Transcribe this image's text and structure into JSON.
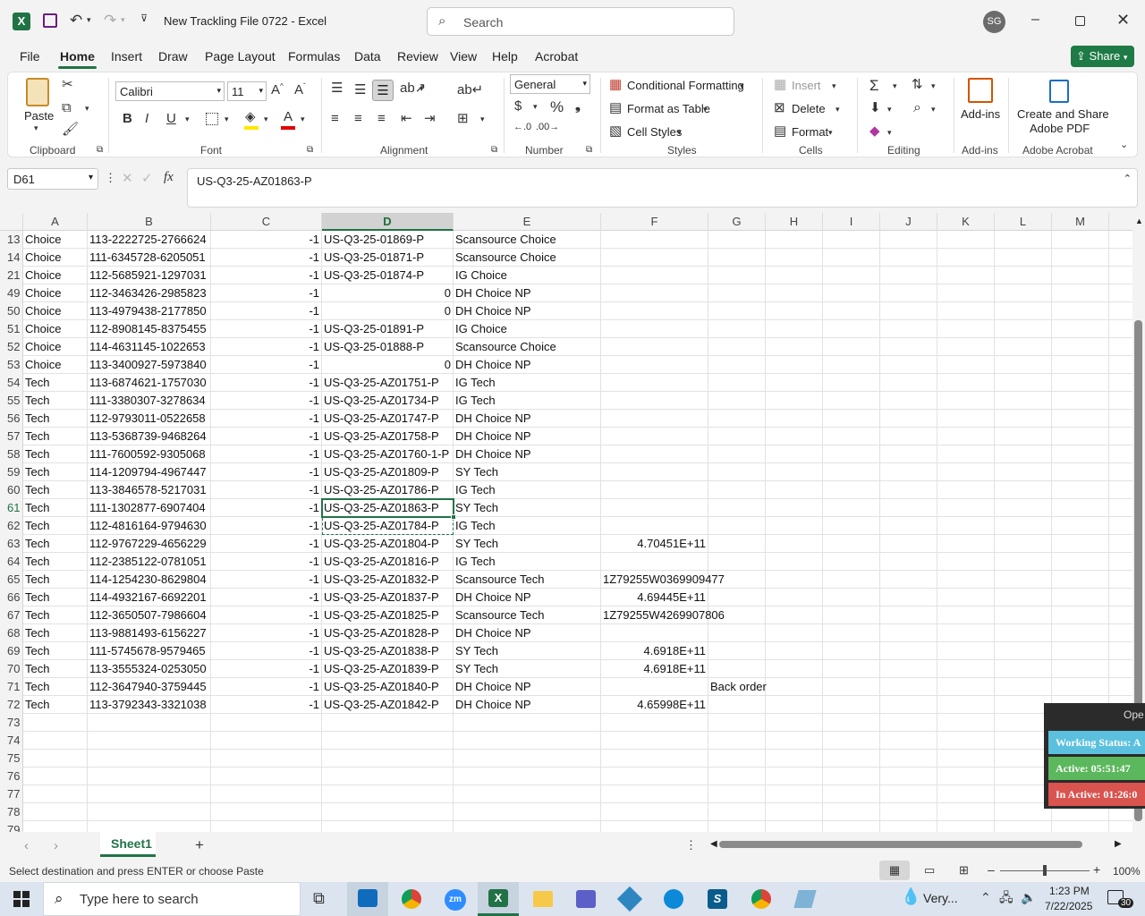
{
  "window": {
    "title": "New Trackling File 0722  -  Excel",
    "search_placeholder": "Search",
    "user_initials": "SG"
  },
  "menu": [
    "File",
    "Home",
    "Insert",
    "Draw",
    "Page Layout",
    "Formulas",
    "Data",
    "Review",
    "View",
    "Help",
    "Acrobat"
  ],
  "share_label": "Share",
  "ribbon": {
    "paste": "Paste",
    "font_name": "Calibri",
    "font_size": "11",
    "number_format": "General",
    "conditional_formatting": "Conditional Formatting",
    "format_as_table": "Format as Table",
    "cell_styles": "Cell Styles",
    "insert": "Insert",
    "delete": "Delete",
    "format": "Format",
    "add_ins": "Add-ins",
    "create_share_1": "Create and Share",
    "create_share_2": "Adobe PDF",
    "groups": {
      "clipboard": "Clipboard",
      "font": "Font",
      "alignment": "Alignment",
      "number": "Number",
      "styles": "Styles",
      "cells": "Cells",
      "editing": "Editing",
      "addins": "Add-ins",
      "acrobat": "Adobe Acrobat"
    }
  },
  "formula_bar": {
    "name_box": "D61",
    "fx": "fx",
    "content": "US-Q3-25-AZ01863-P"
  },
  "columns": [
    "A",
    "B",
    "C",
    "D",
    "E",
    "F",
    "G",
    "H",
    "I",
    "J",
    "K",
    "L",
    "M"
  ],
  "rows": [
    {
      "n": "13",
      "a": "Choice",
      "b": "113-2222725-2766624",
      "c": "-1",
      "d": "US-Q3-25-01869-P",
      "e": "Scansource Choice",
      "f": "",
      "g": ""
    },
    {
      "n": "14",
      "a": "Choice",
      "b": "111-6345728-6205051",
      "c": "-1",
      "d": "US-Q3-25-01871-P",
      "e": "Scansource Choice",
      "f": "",
      "g": ""
    },
    {
      "n": "21",
      "a": "Choice",
      "b": "112-5685921-1297031",
      "c": "-1",
      "d": "US-Q3-25-01874-P",
      "e": "IG Choice",
      "f": "",
      "g": ""
    },
    {
      "n": "49",
      "a": "Choice",
      "b": "112-3463426-2985823",
      "c": "-1",
      "d": "0",
      "e": "DH Choice NP",
      "f": "",
      "g": ""
    },
    {
      "n": "50",
      "a": "Choice",
      "b": "113-4979438-2177850",
      "c": "-1",
      "d": "0",
      "e": "DH Choice NP",
      "f": "",
      "g": ""
    },
    {
      "n": "51",
      "a": "Choice",
      "b": "112-8908145-8375455",
      "c": "-1",
      "d": "US-Q3-25-01891-P",
      "e": "IG Choice",
      "f": "",
      "g": ""
    },
    {
      "n": "52",
      "a": "Choice",
      "b": "114-4631145-1022653",
      "c": "-1",
      "d": "US-Q3-25-01888-P",
      "e": "Scansource Choice",
      "f": "",
      "g": ""
    },
    {
      "n": "53",
      "a": "Choice",
      "b": "113-3400927-5973840",
      "c": "-1",
      "d": "0",
      "e": "DH Choice NP",
      "f": "",
      "g": ""
    },
    {
      "n": "54",
      "a": "Tech",
      "b": "113-6874621-1757030",
      "c": "-1",
      "d": "US-Q3-25-AZ01751-P",
      "e": "IG Tech",
      "f": "",
      "g": ""
    },
    {
      "n": "55",
      "a": "Tech",
      "b": "111-3380307-3278634",
      "c": "-1",
      "d": "US-Q3-25-AZ01734-P",
      "e": "IG Tech",
      "f": "",
      "g": ""
    },
    {
      "n": "56",
      "a": "Tech",
      "b": "112-9793011-0522658",
      "c": "-1",
      "d": "US-Q3-25-AZ01747-P",
      "e": "DH Choice NP",
      "f": "",
      "g": ""
    },
    {
      "n": "57",
      "a": "Tech",
      "b": "113-5368739-9468264",
      "c": "-1",
      "d": "US-Q3-25-AZ01758-P",
      "e": "DH Choice NP",
      "f": "",
      "g": ""
    },
    {
      "n": "58",
      "a": "Tech",
      "b": "111-7600592-9305068",
      "c": "-1",
      "d": "US-Q3-25-AZ01760-1-P",
      "e": "DH Choice NP",
      "f": "",
      "g": ""
    },
    {
      "n": "59",
      "a": "Tech",
      "b": "114-1209794-4967447",
      "c": "-1",
      "d": "US-Q3-25-AZ01809-P",
      "e": "SY Tech",
      "f": "",
      "g": ""
    },
    {
      "n": "60",
      "a": "Tech",
      "b": "113-3846578-5217031",
      "c": "-1",
      "d": "US-Q3-25-AZ01786-P",
      "e": "IG Tech",
      "f": "",
      "g": ""
    },
    {
      "n": "61",
      "a": "Tech",
      "b": "111-1302877-6907404",
      "c": "-1",
      "d": "US-Q3-25-AZ01863-P",
      "e": "SY Tech",
      "f": "",
      "g": ""
    },
    {
      "n": "62",
      "a": "Tech",
      "b": "112-4816164-9794630",
      "c": "-1",
      "d": "US-Q3-25-AZ01784-P",
      "e": "IG Tech",
      "f": "",
      "g": ""
    },
    {
      "n": "63",
      "a": "Tech",
      "b": "112-9767229-4656229",
      "c": "-1",
      "d": "US-Q3-25-AZ01804-P",
      "e": "SY Tech",
      "f": "4.70451E+11",
      "g": ""
    },
    {
      "n": "64",
      "a": "Tech",
      "b": "112-2385122-0781051",
      "c": "-1",
      "d": "US-Q3-25-AZ01816-P",
      "e": "IG Tech",
      "f": "",
      "g": ""
    },
    {
      "n": "65",
      "a": "Tech",
      "b": "114-1254230-8629804",
      "c": "-1",
      "d": "US-Q3-25-AZ01832-P",
      "e": "Scansource Tech",
      "f": "1Z79255W0369909477",
      "g": ""
    },
    {
      "n": "66",
      "a": "Tech",
      "b": "114-4932167-6692201",
      "c": "-1",
      "d": "US-Q3-25-AZ01837-P",
      "e": "DH Choice NP",
      "f": "4.69445E+11",
      "g": ""
    },
    {
      "n": "67",
      "a": "Tech",
      "b": "112-3650507-7986604",
      "c": "-1",
      "d": "US-Q3-25-AZ01825-P",
      "e": "Scansource Tech",
      "f": "1Z79255W4269907806",
      "g": ""
    },
    {
      "n": "68",
      "a": "Tech",
      "b": "113-9881493-6156227",
      "c": "-1",
      "d": "US-Q3-25-AZ01828-P",
      "e": "DH Choice NP",
      "f": "",
      "g": ""
    },
    {
      "n": "69",
      "a": "Tech",
      "b": "111-5745678-9579465",
      "c": "-1",
      "d": "US-Q3-25-AZ01838-P",
      "e": "SY Tech",
      "f": "4.6918E+11",
      "g": ""
    },
    {
      "n": "70",
      "a": "Tech",
      "b": "113-3555324-0253050",
      "c": "-1",
      "d": "US-Q3-25-AZ01839-P",
      "e": "SY Tech",
      "f": "4.6918E+11",
      "g": ""
    },
    {
      "n": "71",
      "a": "Tech",
      "b": "112-3647940-3759445",
      "c": "-1",
      "d": "US-Q3-25-AZ01840-P",
      "e": "DH Choice NP",
      "f": "",
      "g": "Back order"
    },
    {
      "n": "72",
      "a": "Tech",
      "b": "113-3792343-3321038",
      "c": "-1",
      "d": "US-Q3-25-AZ01842-P",
      "e": "DH Choice NP",
      "f": "4.65998E+11",
      "g": ""
    },
    {
      "n": "73",
      "a": "",
      "b": "",
      "c": "",
      "d": "",
      "e": "",
      "f": "",
      "g": ""
    },
    {
      "n": "74",
      "a": "",
      "b": "",
      "c": "",
      "d": "",
      "e": "",
      "f": "",
      "g": ""
    },
    {
      "n": "75",
      "a": "",
      "b": "",
      "c": "",
      "d": "",
      "e": "",
      "f": "",
      "g": ""
    },
    {
      "n": "76",
      "a": "",
      "b": "",
      "c": "",
      "d": "",
      "e": "",
      "f": "",
      "g": ""
    },
    {
      "n": "77",
      "a": "",
      "b": "",
      "c": "",
      "d": "",
      "e": "",
      "f": "",
      "g": ""
    },
    {
      "n": "78",
      "a": "",
      "b": "",
      "c": "",
      "d": "",
      "e": "",
      "f": "",
      "g": ""
    },
    {
      "n": "79",
      "a": "",
      "b": "",
      "c": "",
      "d": "",
      "e": "",
      "f": "",
      "g": ""
    }
  ],
  "sheet_tab": "Sheet1",
  "status": {
    "message": "Select destination and press ENTER or choose Paste",
    "zoom": "100%"
  },
  "widget": {
    "header": "Ope",
    "working": "Working Status: A",
    "active": "Active: 05:51:47",
    "inactive": "In Active: 01:26:0"
  },
  "taskbar": {
    "search_placeholder": "Type here to search",
    "weather": "Very...",
    "time": "1:23 PM",
    "date": "7/22/2025",
    "notif_count": "30"
  },
  "colors": {
    "excel_green": "#217346",
    "share_green": "#1e7b45",
    "active_green": "#5cb85c",
    "inactive_red": "#d9534f",
    "working_teal": "#5bc0de"
  }
}
